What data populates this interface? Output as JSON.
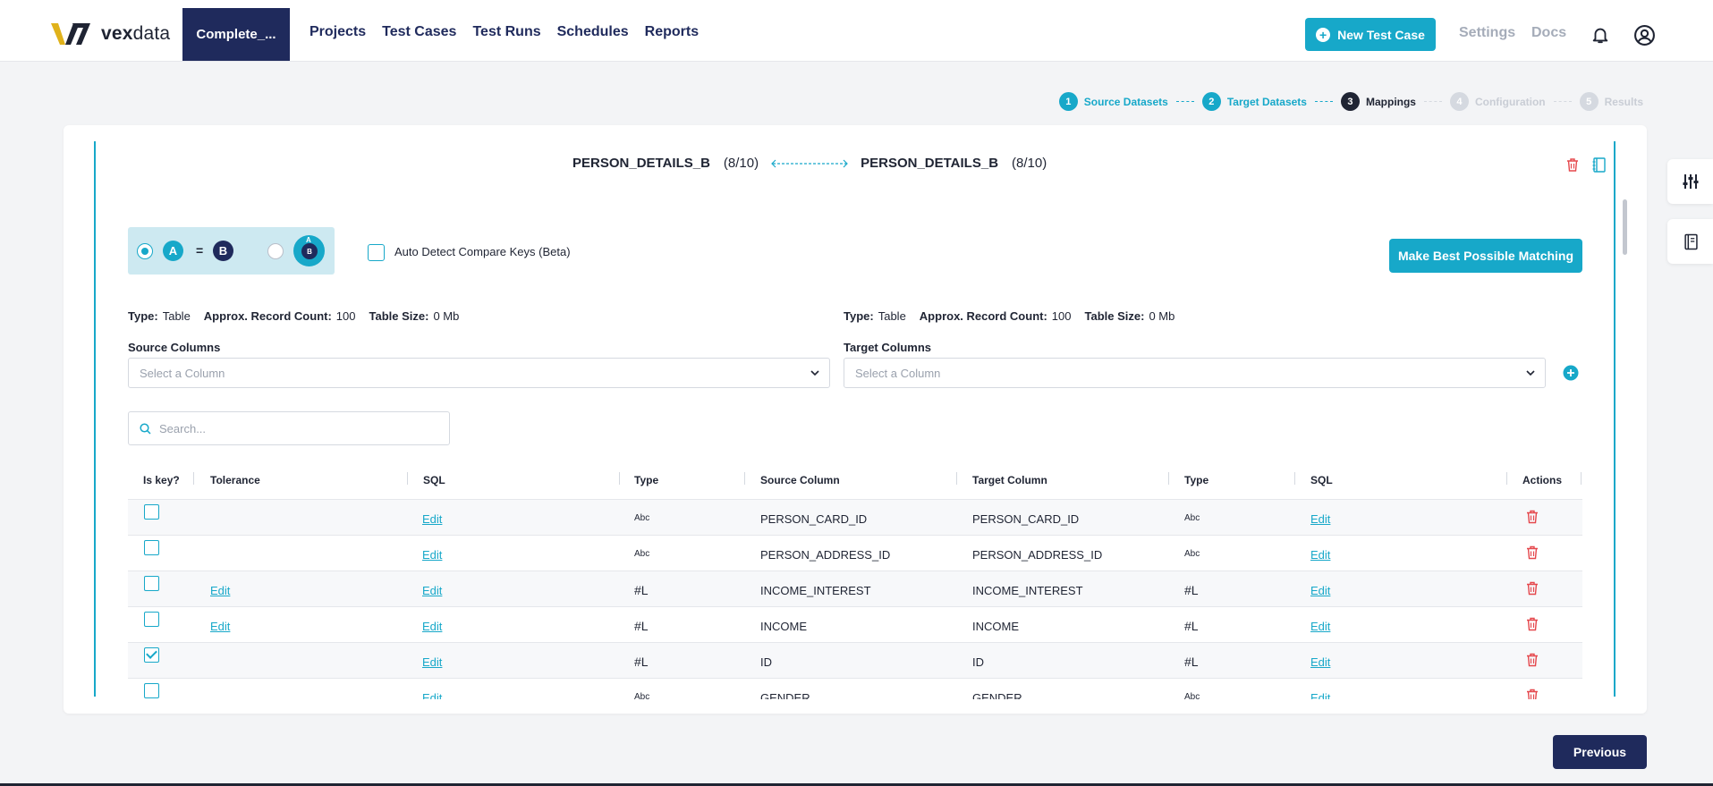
{
  "app": {
    "logo_text_bold": "vex",
    "logo_text_light": "data",
    "project_tab": "Complete_...",
    "nav": [
      "Projects",
      "Test Cases",
      "Test Runs",
      "Schedules",
      "Reports"
    ],
    "new_test_case_label": "New Test Case",
    "settings_label": "Settings",
    "docs_label": "Docs"
  },
  "stepper": {
    "steps": [
      {
        "num": "1",
        "label": "Source Datasets",
        "state": "done"
      },
      {
        "num": "2",
        "label": "Target Datasets",
        "state": "done"
      },
      {
        "num": "3",
        "label": "Mappings",
        "state": "current"
      },
      {
        "num": "4",
        "label": "Configuration",
        "state": "todo"
      },
      {
        "num": "5",
        "label": "Results",
        "state": "todo"
      }
    ]
  },
  "mapping": {
    "source_table": "PERSON_DETAILS_B",
    "source_count": "(8/10)",
    "target_table": "PERSON_DETAILS_B",
    "target_count": "(8/10)",
    "badge_a": "A",
    "badge_b": "B",
    "eq": "=",
    "auto_detect_label": "Auto Detect Compare Keys (Beta)",
    "best_match_label": "Make Best Possible Matching",
    "source_meta": {
      "type_label": "Type:",
      "type": "Table",
      "count_label": "Approx. Record Count:",
      "count": "100",
      "size_label": "Table Size:",
      "size": "0 Mb"
    },
    "target_meta": {
      "type_label": "Type:",
      "type": "Table",
      "count_label": "Approx. Record Count:",
      "count": "100",
      "size_label": "Table Size:",
      "size": "0 Mb"
    },
    "source_columns_label": "Source Columns",
    "target_columns_label": "Target Columns",
    "select_placeholder": "Select a Column",
    "search_placeholder": "Search..."
  },
  "table": {
    "headers": [
      "Is key?",
      "Tolerance",
      "SQL",
      "Type",
      "Source Column",
      "Target Column",
      "Type",
      "SQL",
      "Actions"
    ],
    "edit_label": "Edit",
    "rows": [
      {
        "key": false,
        "tolerance": "",
        "src_type": "Abc",
        "source": "PERSON_CARD_ID",
        "target": "PERSON_CARD_ID",
        "tgt_type": "Abc"
      },
      {
        "key": false,
        "tolerance": "",
        "src_type": "Abc",
        "source": "PERSON_ADDRESS_ID",
        "target": "PERSON_ADDRESS_ID",
        "tgt_type": "Abc"
      },
      {
        "key": false,
        "tolerance": "Edit",
        "src_type": "#L",
        "source": "INCOME_INTEREST",
        "target": "INCOME_INTEREST",
        "tgt_type": "#L"
      },
      {
        "key": false,
        "tolerance": "Edit",
        "src_type": "#L",
        "source": "INCOME",
        "target": "INCOME",
        "tgt_type": "#L"
      },
      {
        "key": true,
        "tolerance": "",
        "src_type": "#L",
        "source": "ID",
        "target": "ID",
        "tgt_type": "#L"
      },
      {
        "key": false,
        "tolerance": "",
        "src_type": "Abc",
        "source": "GENDER",
        "target": "GENDER",
        "tgt_type": "Abc"
      }
    ]
  },
  "footer": {
    "previous_label": "Previous"
  },
  "colors": {
    "accent": "#17a8c9",
    "navy": "#1f2a5c",
    "danger": "#e5484d"
  }
}
